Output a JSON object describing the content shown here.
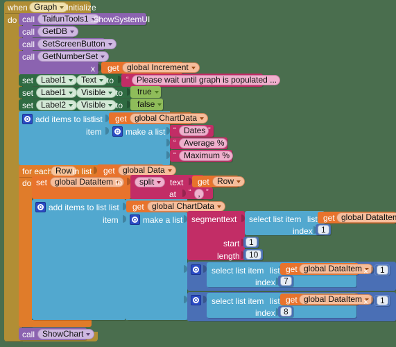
{
  "editor": {
    "name": "MIT App Inventor Blocks Editor",
    "background_color": "#4a6e4e"
  },
  "colors": {
    "event": "#b18e35",
    "procedure": "#8b63b0",
    "setter": "#2f6b42",
    "list": "#52a8cf",
    "control": "#e07c2a",
    "variable": "#e8732c",
    "text": "#c22d66",
    "math": "#4a6fb5",
    "logic": "#8fbc5a"
  },
  "event_block": {
    "when": "when",
    "component": "Graph",
    "event": ".Initialize",
    "do": "do"
  },
  "calls": [
    {
      "call": "call",
      "name": "TaifunTools1",
      "method": ".ShowSystemUI"
    },
    {
      "call": "call",
      "name": "GetDB",
      "method": ""
    },
    {
      "call": "call",
      "name": "SetScreenButton",
      "method": ""
    },
    {
      "call": "call",
      "name": "GetNumberSet",
      "method": "",
      "arg_label": "x",
      "arg_get": "get",
      "arg_value": "global Increment"
    }
  ],
  "setters": [
    {
      "set": "set",
      "component": "Label1",
      "property": "Text",
      "to": "to",
      "value_type": "text",
      "value": "Please wait until graph is populated ..."
    },
    {
      "set": "set",
      "component": "Label1",
      "property": "Visible",
      "to": "to",
      "value_type": "logic",
      "value": "true"
    },
    {
      "set": "set",
      "component": "Label2",
      "property": "Visible",
      "to": "to",
      "value_type": "logic",
      "value": "false"
    }
  ],
  "add_items_outer": {
    "title": "add items to list",
    "list_label": "list",
    "list_get": "get",
    "list_value": "global ChartData",
    "item_label": "item",
    "make_a_list": "make a list",
    "items": [
      "Dates",
      "Average %",
      "Maximum %"
    ]
  },
  "for_each": {
    "for_each": "for each",
    "var": "Row",
    "in_list": "in list",
    "list_get": "get",
    "list_value": "global Data",
    "do": "do"
  },
  "set_dataitem": {
    "set": "set",
    "var": "global DataItem",
    "to": "to",
    "split": "split",
    "text_label": "text",
    "text_get": "get",
    "text_value": "Row",
    "at_label": "at",
    "at_value": ","
  },
  "add_items_inner": {
    "title": "add items to list",
    "list_label": "list",
    "list_get": "get",
    "list_value": "global ChartData",
    "item_label": "item",
    "make_a_list": "make a list",
    "segment": {
      "name": "segment",
      "text_label": "text",
      "select": "select list item",
      "list_label": "list",
      "get": "get",
      "value": "global DataItem",
      "index_label": "index",
      "index_value": "1",
      "start_label": "start",
      "start_value": "1",
      "length_label": "length",
      "length_value": "10"
    },
    "multiplications": [
      {
        "select": "select list item",
        "list_label": "list",
        "get": "get",
        "value": "global DataItem",
        "index_label": "index",
        "index_value": "7",
        "operator": "×",
        "factor": "1"
      },
      {
        "select": "select list item",
        "list_label": "list",
        "get": "get",
        "value": "global DataItem",
        "index_label": "index",
        "index_value": "8",
        "operator": "×",
        "factor": "1"
      }
    ]
  },
  "final_call": {
    "call": "call",
    "name": "ShowChart"
  }
}
